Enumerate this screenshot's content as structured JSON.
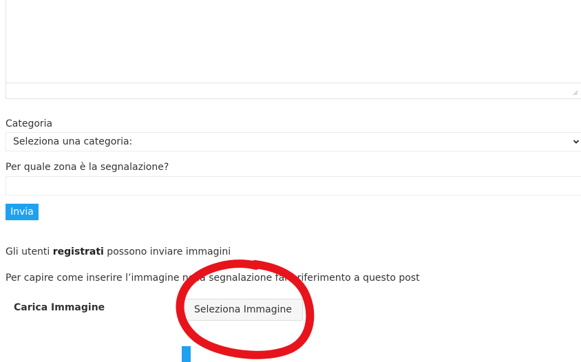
{
  "form": {
    "category_label": "Categoria",
    "category_selected": "Seleziona una categoria:",
    "zone_label": "Per quale zona è la segnalazione?",
    "zone_value": "",
    "submit_label": "Invia"
  },
  "upload": {
    "notice_prefix": "Gli utenti ",
    "notice_bold": "registrati",
    "notice_suffix": " possono inviare immagini",
    "help_text": "Per capire come inserire l’immagine nella segnalazione fare riferimento a questo post",
    "label": "Carica Immagine",
    "button_label": "Seleziona Immagine"
  },
  "colors": {
    "accent": "#1fa1ef",
    "annotation": "#e8141c"
  },
  "icons": {
    "select": "chevron-down-icon",
    "textarea": "resize-grip-icon"
  }
}
